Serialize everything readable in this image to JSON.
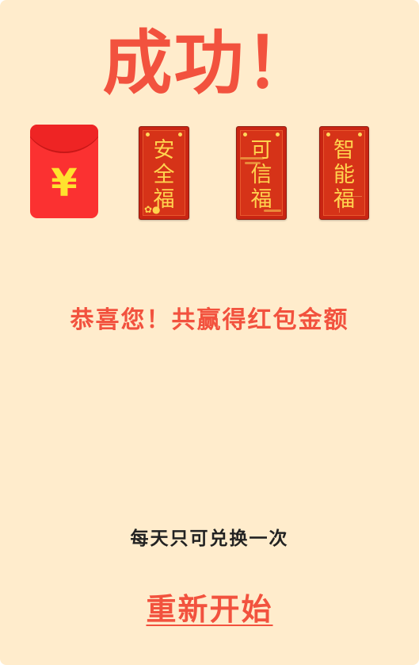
{
  "title": "成功！",
  "envelope": {
    "symbol": "¥",
    "color": "#fb3131",
    "symbol_color": "#ffe22e"
  },
  "cards": [
    {
      "chars": [
        "安",
        "全",
        "福"
      ],
      "decoration": "flower-icon"
    },
    {
      "chars": [
        "可",
        "信",
        "福"
      ],
      "decoration": "cloud-icon"
    },
    {
      "chars": [
        "智",
        "能",
        "福"
      ],
      "decoration": "firework-icon"
    }
  ],
  "congrats_text": "恭喜您！共赢得红包金额",
  "limit_text": "每天只可兑换一次",
  "restart_label": "重新开始",
  "colors": {
    "background": "#ffeccc",
    "accent": "#f2523e",
    "card": "#d63318",
    "card_text": "#ffd34e"
  }
}
